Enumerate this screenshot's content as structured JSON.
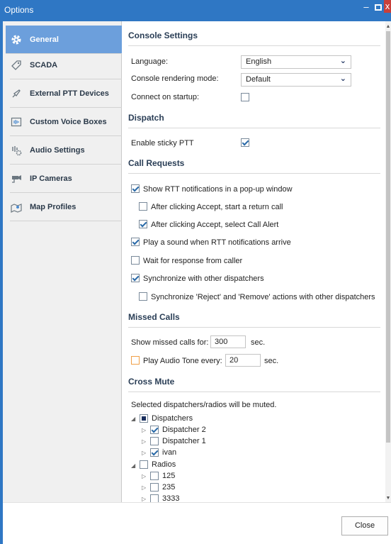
{
  "window": {
    "title": "Options",
    "minimize": "–",
    "close": "x"
  },
  "sidebar": {
    "items": [
      {
        "label": "General",
        "icon": "gear-icon"
      },
      {
        "label": "SCADA",
        "icon": "tag-icon"
      },
      {
        "label": "External PTT Devices",
        "icon": "ptt-device-icon"
      },
      {
        "label": "Custom Voice Boxes",
        "icon": "voice-box-icon"
      },
      {
        "label": "Audio Settings",
        "icon": "audio-settings-icon"
      },
      {
        "label": "IP Cameras",
        "icon": "camera-icon"
      },
      {
        "label": "Map Profiles",
        "icon": "map-icon"
      }
    ]
  },
  "console_settings": {
    "title": "Console Settings",
    "language_label": "Language:",
    "language_value": "English",
    "rendering_label": "Console rendering mode:",
    "rendering_value": "Default",
    "connect_label": "Connect on startup:",
    "connect_checked": false
  },
  "dispatch": {
    "title": "Dispatch",
    "sticky_label": "Enable sticky PTT",
    "sticky_checked": true
  },
  "call_requests": {
    "title": "Call Requests",
    "options": [
      {
        "label": "Show RTT notifications in a pop-up window",
        "checked": true
      },
      {
        "label": "After clicking Accept, start a return call",
        "checked": false
      },
      {
        "label": "After clicking Accept, select Call Alert",
        "checked": true
      },
      {
        "label": "Play a sound when RTT notifications arrive",
        "checked": true
      },
      {
        "label": "Wait for response from caller",
        "checked": false
      },
      {
        "label": "Synchronize with other dispatchers",
        "checked": true
      },
      {
        "label": "Synchronize 'Reject' and 'Remove' actions with other dispatchers",
        "checked": false
      }
    ]
  },
  "missed_calls": {
    "title": "Missed Calls",
    "show_label": "Show missed calls for:",
    "show_value": "300",
    "show_unit": "sec.",
    "tone_label": "Play Audio Tone every:",
    "tone_value": "20",
    "tone_unit": "sec.",
    "tone_checked": false
  },
  "cross_mute": {
    "title": "Cross Mute",
    "description": "Selected dispatchers/radios will be muted.",
    "dispatchers": {
      "label": "Dispatchers",
      "children": [
        {
          "label": "Dispatcher 2",
          "checked": true
        },
        {
          "label": "Dispatcher 1",
          "checked": false
        },
        {
          "label": "ivan",
          "checked": true
        }
      ]
    },
    "radios": {
      "label": "Radios",
      "children": [
        {
          "label": "125",
          "checked": false
        },
        {
          "label": "235",
          "checked": false
        },
        {
          "label": "3333",
          "checked": false
        }
      ]
    }
  },
  "footer": {
    "close_label": "Close"
  },
  "colors": {
    "titlebar": "#2f77c4",
    "active_nav": "#6c9fdc",
    "section_title": "#2a3e56",
    "close_button": "#c9403a"
  }
}
